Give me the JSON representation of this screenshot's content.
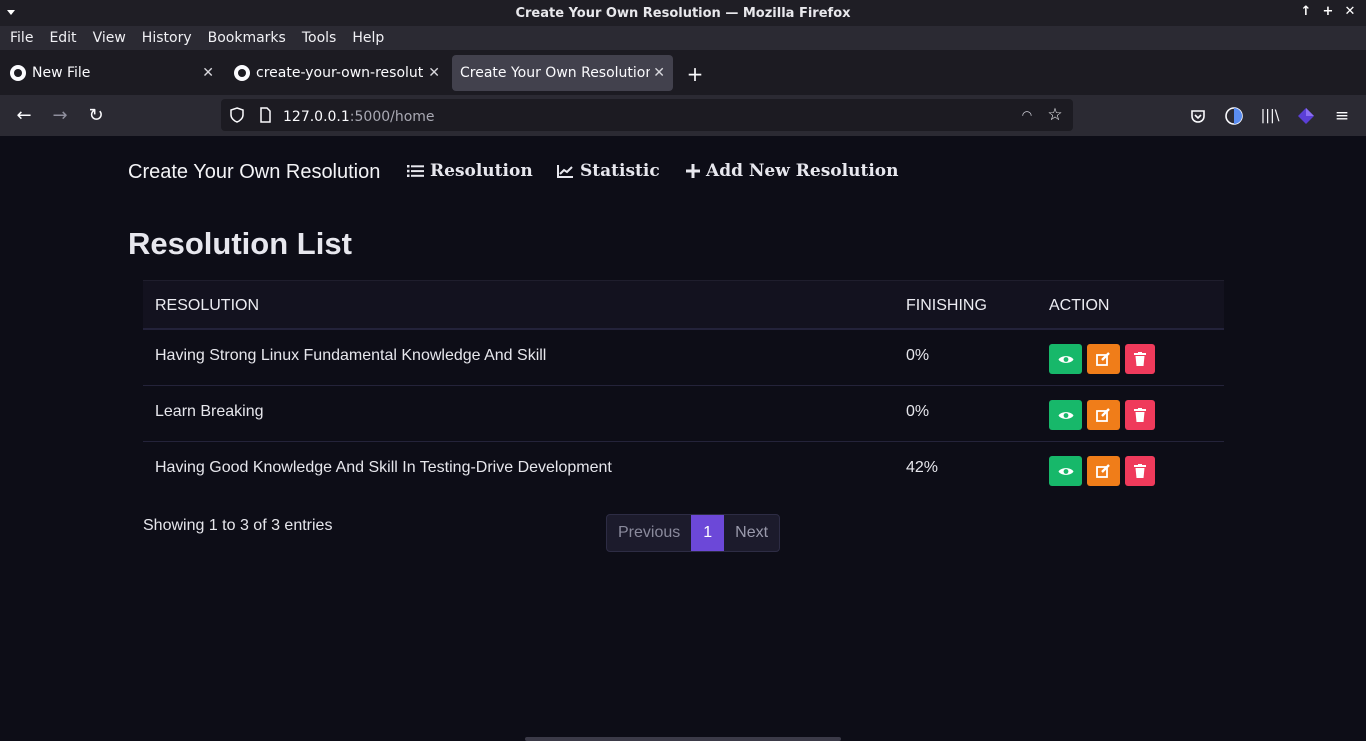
{
  "window": {
    "title": "Create Your Own Resolution — Mozilla Firefox"
  },
  "menu": [
    "File",
    "Edit",
    "View",
    "History",
    "Bookmarks",
    "Tools",
    "Help"
  ],
  "tabs": [
    {
      "label": "New File",
      "icon": "github-icon",
      "active": false
    },
    {
      "label": "create-your-own-resolutio",
      "icon": "github-icon",
      "active": false
    },
    {
      "label": "Create Your Own Resolution",
      "icon": "",
      "active": true
    }
  ],
  "url": {
    "host": "127.0.0.1",
    "path": ":5000/home"
  },
  "site": {
    "brand": "Create Your Own Resolution",
    "nav": [
      {
        "label": "Resolution",
        "icon": "list-icon"
      },
      {
        "label": "Statistic",
        "icon": "chart-line-icon"
      },
      {
        "label": "Add New Resolution",
        "icon": "plus-icon"
      }
    ]
  },
  "main": {
    "title": "Resolution List",
    "headers": {
      "resolution": "RESOLUTION",
      "finishing": "FINISHING",
      "action": "ACTION"
    },
    "rows": [
      {
        "resolution": "Having Strong Linux Fundamental Knowledge And Skill",
        "finishing": "0%"
      },
      {
        "resolution": "Learn Breaking",
        "finishing": "0%"
      },
      {
        "resolution": "Having Good Knowledge And Skill In Testing-Drive Development",
        "finishing": "42%"
      }
    ],
    "entries": "Showing 1 to 3 of 3 entries",
    "pagination": {
      "previous": "Previous",
      "current": "1",
      "next": "Next"
    }
  },
  "colors": {
    "view": "#17b86a",
    "edit": "#f07d19",
    "delete": "#ef3a5b",
    "page_active": "#6c48d8"
  }
}
